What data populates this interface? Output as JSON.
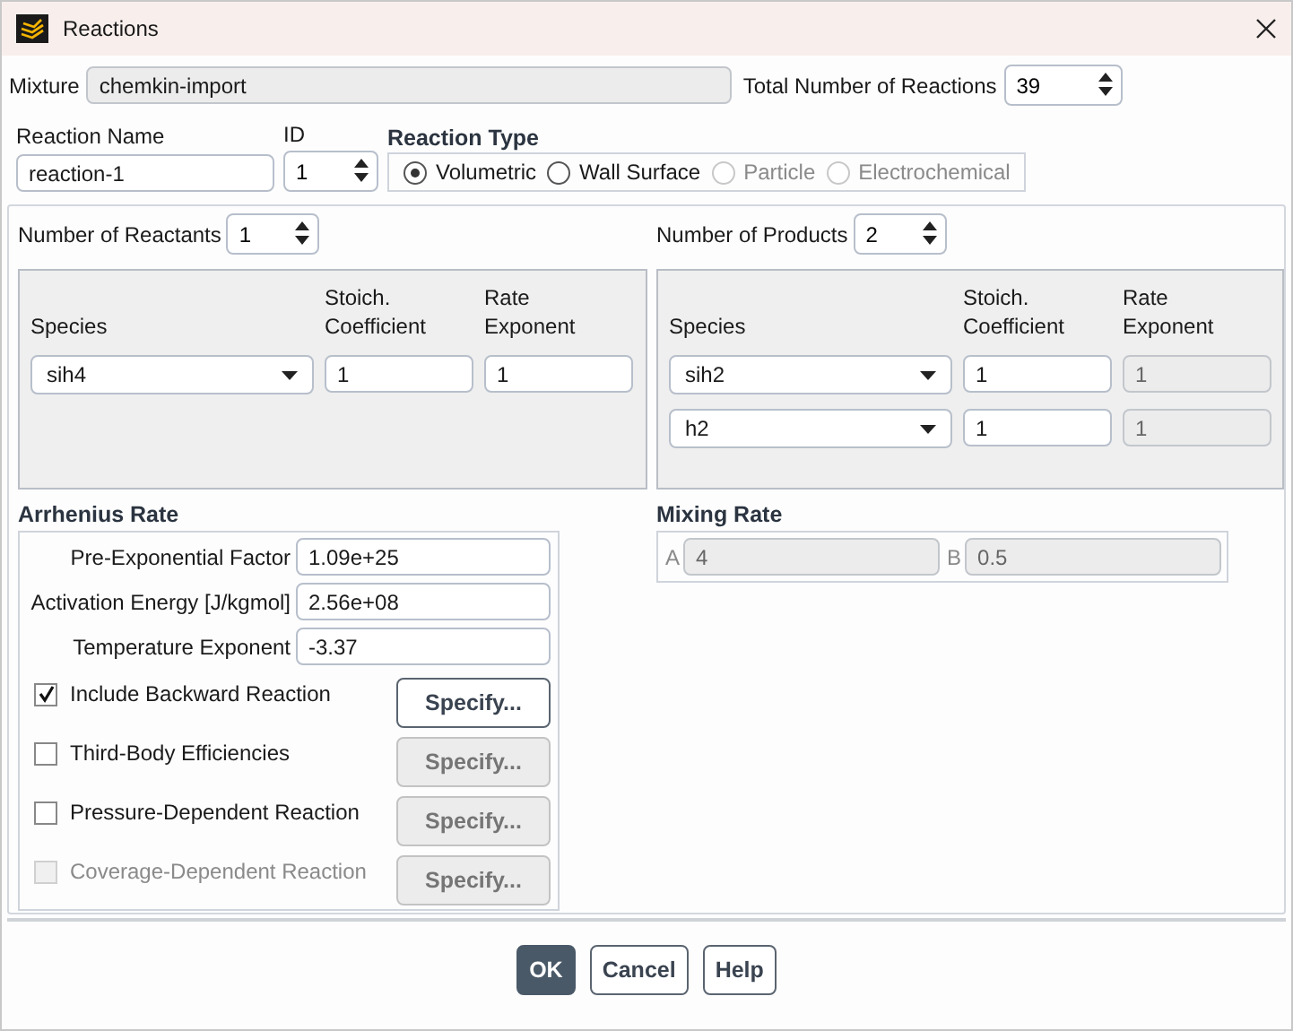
{
  "window": {
    "title": "Reactions"
  },
  "mixture": {
    "label": "Mixture",
    "value": "chemkin-import",
    "disabled": true
  },
  "total_reactions": {
    "label": "Total Number of Reactions",
    "value": "39"
  },
  "reaction_name": {
    "label": "Reaction Name",
    "value": "reaction-1"
  },
  "reaction_id": {
    "label": "ID",
    "value": "1"
  },
  "reaction_type": {
    "title": "Reaction Type",
    "options": [
      {
        "label": "Volumetric",
        "selected": true,
        "disabled": false
      },
      {
        "label": "Wall Surface",
        "selected": false,
        "disabled": false
      },
      {
        "label": "Particle",
        "selected": false,
        "disabled": true
      },
      {
        "label": "Electrochemical",
        "selected": false,
        "disabled": true
      }
    ]
  },
  "reactants": {
    "label": "Number of Reactants",
    "count": "1",
    "columns": [
      "Species",
      "Stoich.\nCoefficient",
      "Rate\nExponent"
    ],
    "rows": [
      {
        "species": "sih4",
        "stoich": "1",
        "rate": "1",
        "rate_disabled": false
      }
    ]
  },
  "products": {
    "label": "Number of Products",
    "count": "2",
    "columns": [
      "Species",
      "Stoich.\nCoefficient",
      "Rate\nExponent"
    ],
    "rows": [
      {
        "species": "sih2",
        "stoich": "1",
        "rate": "1",
        "rate_disabled": true
      },
      {
        "species": "h2",
        "stoich": "1",
        "rate": "1",
        "rate_disabled": true
      }
    ]
  },
  "arrhenius": {
    "title": "Arrhenius Rate",
    "fields": [
      {
        "label": "Pre-Exponential Factor",
        "value": "1.09e+25"
      },
      {
        "label": "Activation Energy [J/kgmol]",
        "value": "2.56e+08"
      },
      {
        "label": "Temperature Exponent",
        "value": "-3.37"
      }
    ],
    "options": [
      {
        "label": "Include Backward Reaction",
        "checked": true,
        "disabled": false,
        "button": {
          "label": "Specify...",
          "disabled": false
        }
      },
      {
        "label": "Third-Body Efficiencies",
        "checked": false,
        "disabled": false,
        "button": {
          "label": "Specify...",
          "disabled": true
        }
      },
      {
        "label": "Pressure-Dependent Reaction",
        "checked": false,
        "disabled": false,
        "button": {
          "label": "Specify...",
          "disabled": true
        }
      },
      {
        "label": "Coverage-Dependent Reaction",
        "checked": false,
        "disabled": true,
        "button": {
          "label": "Specify...",
          "disabled": true
        }
      }
    ]
  },
  "mixing": {
    "title": "Mixing Rate",
    "fields": [
      {
        "label": "A",
        "value": "4",
        "disabled": true
      },
      {
        "label": "B",
        "value": "0.5",
        "disabled": true
      }
    ]
  },
  "buttons": [
    {
      "label": "OK",
      "primary": true
    },
    {
      "label": "Cancel",
      "primary": false
    },
    {
      "label": "Help",
      "primary": false
    }
  ]
}
